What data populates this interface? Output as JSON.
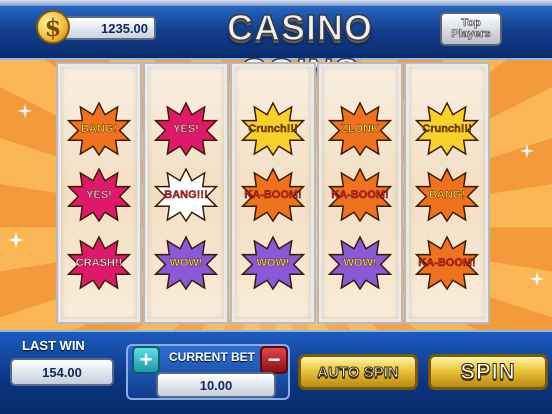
{
  "header": {
    "title": "CASINO COINS",
    "currency_symbol": "$",
    "balance": "1235.00",
    "top_players_line1": "Top",
    "top_players_line2": "Players"
  },
  "reels": [
    {
      "symbols": [
        {
          "text": "BANG!",
          "burst": "#f0721e",
          "text_color": "#ffe14a"
        },
        {
          "text": "YES!",
          "burst": "#e0186a",
          "text_color": "#ffd6ea"
        },
        {
          "text": "CRASH!!",
          "burst": "#e0186a",
          "text_color": "#ffffff"
        }
      ]
    },
    {
      "symbols": [
        {
          "text": "YES!",
          "burst": "#e0186a",
          "text_color": "#ffd6ea"
        },
        {
          "text": "BANG!!!",
          "burst": "#ffffff",
          "text_color": "#e01a2a"
        },
        {
          "text": "WOW!",
          "burst": "#8a58d8",
          "text_color": "#ffe14a"
        }
      ]
    },
    {
      "symbols": [
        {
          "text": "Crunch!!!",
          "burst": "#f6d22a",
          "text_color": "#8a4a00"
        },
        {
          "text": "KA-BOOM!",
          "burst": "#f0721e",
          "text_color": "#e01a2a"
        },
        {
          "text": "WOW!",
          "burst": "#8a58d8",
          "text_color": "#ffe14a"
        }
      ]
    },
    {
      "symbols": [
        {
          "text": "ZLONK",
          "burst": "#f0721e",
          "text_color": "#ffe14a"
        },
        {
          "text": "KA-BOOM!",
          "burst": "#f0721e",
          "text_color": "#e01a2a"
        },
        {
          "text": "WOW!",
          "burst": "#8a58d8",
          "text_color": "#ffe14a"
        }
      ]
    },
    {
      "symbols": [
        {
          "text": "Crunch!!!",
          "burst": "#f6d22a",
          "text_color": "#8a4a00"
        },
        {
          "text": "BANG!",
          "burst": "#f0721e",
          "text_color": "#ffe14a"
        },
        {
          "text": "KA-BOOM!",
          "burst": "#f0721e",
          "text_color": "#e01a2a"
        }
      ]
    }
  ],
  "footer": {
    "last_win_label": "LAST WIN",
    "last_win_value": "154.00",
    "current_bet_label": "CURRENT BET",
    "current_bet_value": "10.00",
    "plus_label": "+",
    "minus_label": "−",
    "auto_spin_label": "AUTO SPIN",
    "spin_label": "SPIN"
  },
  "colors": {
    "bar_blue": "#123d8a",
    "gold": "#e9c43a",
    "background_orange": "#f39a3a"
  }
}
